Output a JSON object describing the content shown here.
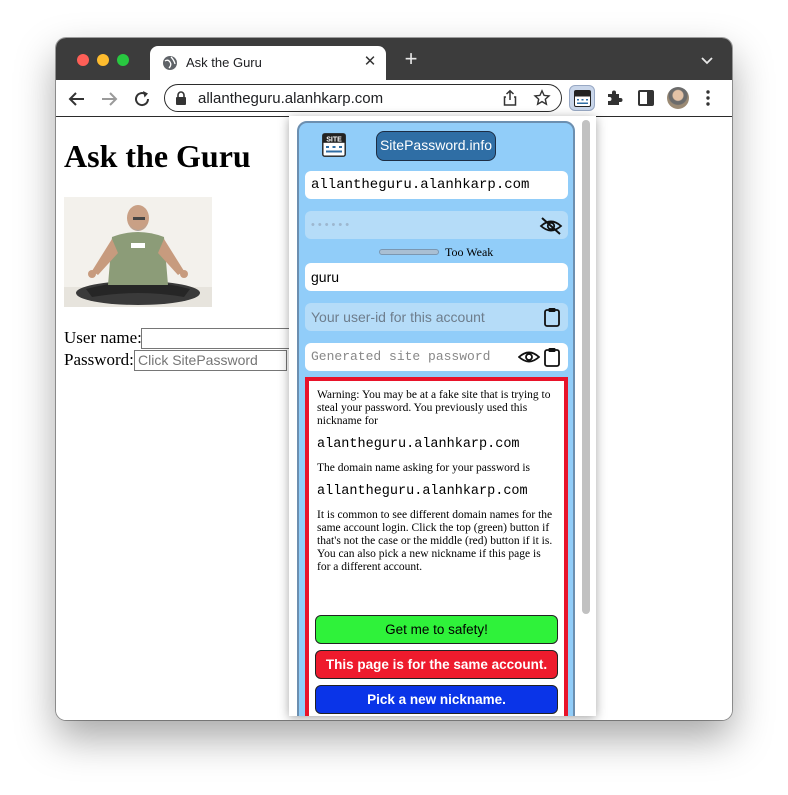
{
  "browser": {
    "tab_title": "Ask the Guru",
    "tab_close": "✕",
    "new_tab": "+",
    "url": "allantheguru.alanhkarp.com"
  },
  "page": {
    "heading": "Ask the Guru",
    "username_label": "User name:",
    "password_label": "Password:",
    "username_value": "",
    "password_placeholder": "Click SitePassword"
  },
  "extension": {
    "title": "SitePassword.info",
    "domain": "allantheguru.alanhkarp.com",
    "master_password": "••••••",
    "strength": "Too Weak",
    "nickname": "guru",
    "userid_placeholder": "Your user-id for this account",
    "site_password_placeholder": "Generated site password",
    "warning": {
      "intro": "Warning: You may be at a fake site that is trying to steal your password. You previously used this nickname for",
      "previous_domain": "alantheguru.alanhkarp.com",
      "asking_text": "The domain name asking for your password is",
      "current_domain": "allantheguru.alanhkarp.com",
      "explanation": "It is common to see different domain names for the same account login. Click the top (green) button if that's not the case or the middle (red) button if it is. You can also pick a new nickname if this page is for a different account.",
      "safety_button": "Get me to safety!",
      "same_account_button": "This page is for the same account.",
      "new_nickname_button": "Pick a new nickname."
    }
  }
}
